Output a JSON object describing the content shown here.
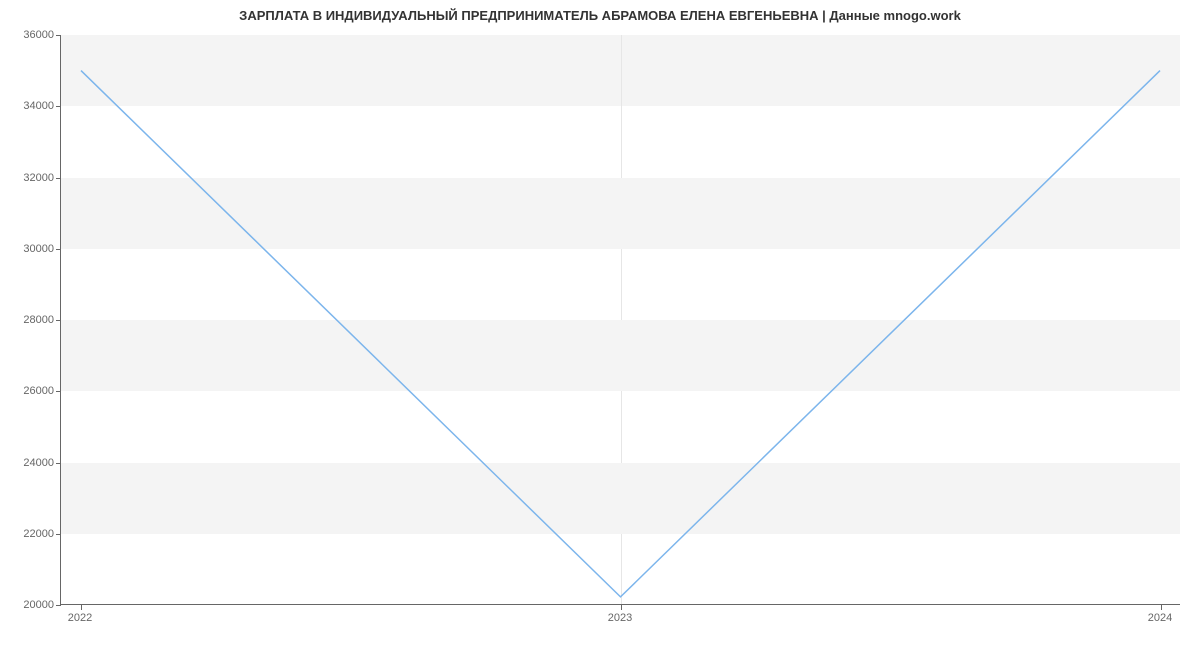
{
  "chart_data": {
    "type": "line",
    "title": "ЗАРПЛАТА В ИНДИВИДУАЛЬНЫЙ ПРЕДПРИНИМАТЕЛЬ АБРАМОВА ЕЛЕНА ЕВГЕНЬЕВНА | Данные mnogo.work",
    "categories": [
      "2022",
      "2023",
      "2024"
    ],
    "values": [
      35000,
      20200,
      35000
    ],
    "xlabel": "",
    "ylabel": "",
    "ylim": [
      20000,
      36000
    ],
    "yticks": [
      20000,
      22000,
      24000,
      26000,
      28000,
      30000,
      32000,
      34000,
      36000
    ],
    "line_color": "#7cb5ec",
    "band_color": "#f4f4f4"
  }
}
